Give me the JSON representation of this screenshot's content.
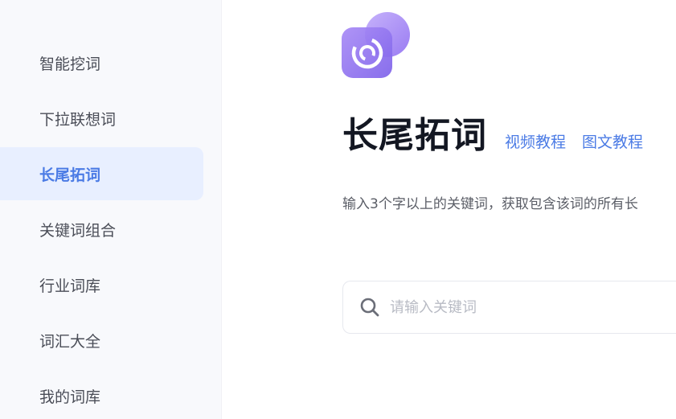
{
  "sidebar": {
    "items": [
      {
        "label": "智能挖词",
        "active": false
      },
      {
        "label": "下拉联想词",
        "active": false
      },
      {
        "label": "长尾拓词",
        "active": true
      },
      {
        "label": "关键词组合",
        "active": false
      },
      {
        "label": "行业词库",
        "active": false
      },
      {
        "label": "词汇大全",
        "active": false
      },
      {
        "label": "我的词库",
        "active": false
      }
    ]
  },
  "main": {
    "logo_icon": "target-ring-icon",
    "title": "长尾拓词",
    "links": [
      "视频教程",
      "图文教程"
    ],
    "description": "输入3个字以上的关键词，获取包含该词的所有长",
    "search": {
      "placeholder": "请输入关键词",
      "value": ""
    }
  },
  "colors": {
    "accent": "#4b7be5",
    "active_bg": "#e8efff",
    "sidebar_bg": "#f8f9fc",
    "logo_purple": "#9b7bf0"
  }
}
